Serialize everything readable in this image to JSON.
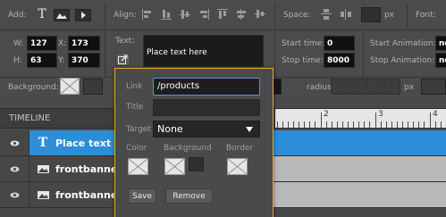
{
  "toolbar": {
    "add_label": "Add:",
    "align_label": "Align:",
    "space_label": "Space:",
    "space_unit": "px",
    "font_label": "Font:"
  },
  "props": {
    "w_label": "W:",
    "w_value": "127",
    "x_label": "X:",
    "x_value": "173",
    "h_label": "H:",
    "h_value": "63",
    "y_label": "Y:",
    "y_value": "370",
    "text_label": "Text:",
    "text_value": "Place text here",
    "start_time_label": "Start time:",
    "start_time_value": "0",
    "stop_time_label": "Stop time:",
    "stop_time_value": "8000",
    "start_anim_label": "Start Animation:",
    "start_anim_value": "no",
    "stop_anim_label": "Stop Animation:",
    "stop_anim_value": "no",
    "background_label": "Background:",
    "radius_label": "radius",
    "radius_unit": "px"
  },
  "timeline": {
    "title": "TIMELINE",
    "ruler_ticks": [
      "2",
      "3",
      "4"
    ],
    "rows": [
      {
        "name": "Place text",
        "type": "text",
        "selected": true
      },
      {
        "name": "frontbanne",
        "type": "image",
        "selected": false
      },
      {
        "name": "frontbanne",
        "type": "image",
        "selected": false
      }
    ]
  },
  "link_popover": {
    "link_label": "Link",
    "link_value": "/products",
    "title_label": "Title",
    "title_value": "",
    "target_label": "Target",
    "target_value": "None",
    "color_label": "Color",
    "background_label": "Background",
    "border_label": "Border",
    "save_label": "Save",
    "remove_label": "Remove"
  },
  "colors": {
    "accent_border": "#e0ad2b",
    "selected_row": "#2c8ed6",
    "track_gray": "#b8b8b8",
    "link_focus": "#5b8fd9"
  }
}
